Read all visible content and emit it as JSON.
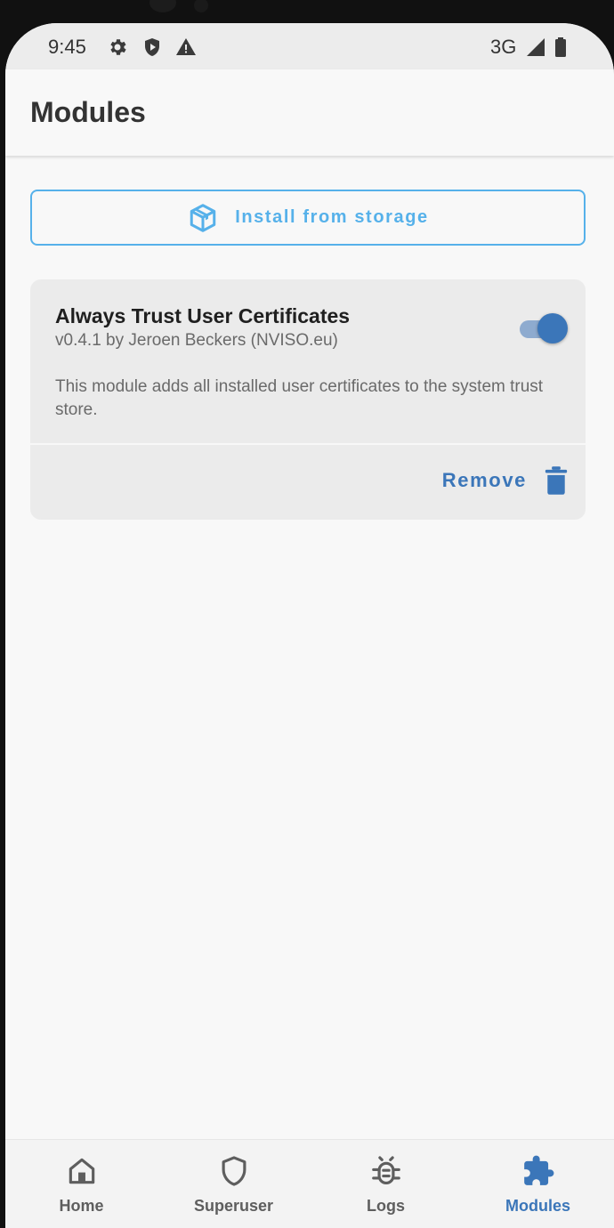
{
  "status_bar": {
    "time": "9:45",
    "icons": [
      "gear-icon",
      "play-shield-icon",
      "warning-icon"
    ],
    "network": "3G",
    "signal_icon": "signal-icon",
    "battery_icon": "battery-icon"
  },
  "app_bar": {
    "title": "Modules"
  },
  "install_button": {
    "label": "Install from storage",
    "icon": "package-icon",
    "color": "#56b1ea"
  },
  "modules": [
    {
      "name": "Always Trust User Certificates",
      "meta": "v0.4.1 by Jeroen Beckers (NVISO.eu)",
      "description": "This module adds all installed user certificates to the system trust store.",
      "enabled": true,
      "remove_label": "Remove",
      "remove_icon": "trash-icon"
    }
  ],
  "bottom_nav": {
    "active": "Modules",
    "active_color": "#3b76b9",
    "items": [
      {
        "label": "Home",
        "icon": "home-icon"
      },
      {
        "label": "Superuser",
        "icon": "shield-icon"
      },
      {
        "label": "Logs",
        "icon": "bug-icon"
      },
      {
        "label": "Modules",
        "icon": "puzzle-icon"
      }
    ]
  }
}
